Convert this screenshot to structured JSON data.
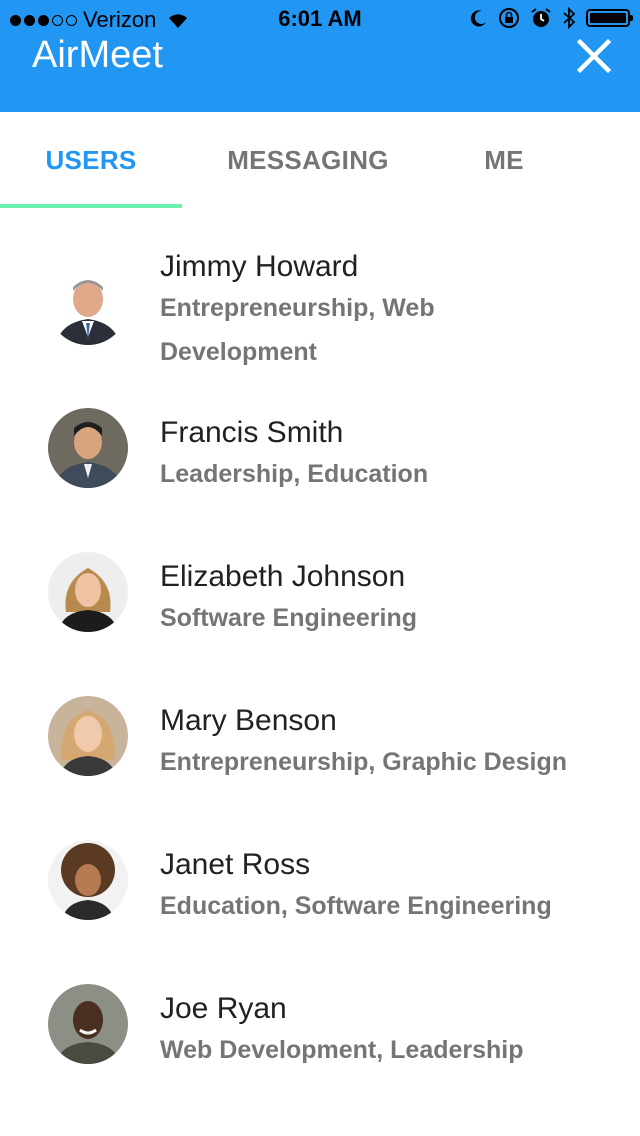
{
  "status_bar": {
    "carrier": "Verizon",
    "time": "6:01 AM"
  },
  "app": {
    "title": "AirMeet",
    "close_icon": "close-icon",
    "accent_color": "#2196F3",
    "indicator_color": "#69F0AE"
  },
  "tabs": [
    {
      "label": "USERS",
      "active": true
    },
    {
      "label": "MESSAGING",
      "active": false
    },
    {
      "label": "ME",
      "active": false
    }
  ],
  "users": [
    {
      "name": "Jimmy Howard",
      "interests": "Entrepreneurship, Web Development"
    },
    {
      "name": "Francis Smith",
      "interests": "Leadership, Education"
    },
    {
      "name": "Elizabeth Johnson",
      "interests": "Software Engineering"
    },
    {
      "name": "Mary Benson",
      "interests": "Entrepreneurship, Graphic Design"
    },
    {
      "name": "Janet Ross",
      "interests": "Education, Software Engineering"
    },
    {
      "name": "Joe Ryan",
      "interests": "Web Development, Leadership"
    }
  ]
}
